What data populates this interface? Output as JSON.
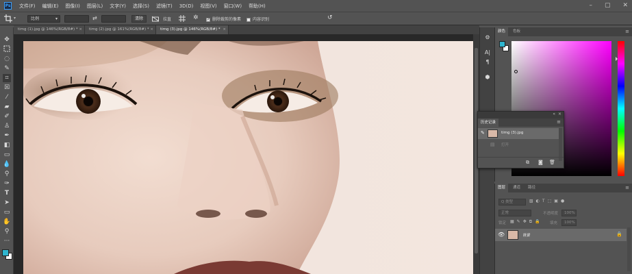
{
  "menubar": {
    "items": [
      "文件(F)",
      "编辑(E)",
      "图像(I)",
      "图层(L)",
      "文字(Y)",
      "选择(S)",
      "滤镜(T)",
      "3D(D)",
      "视图(V)",
      "窗口(W)",
      "帮助(H)"
    ]
  },
  "options_bar": {
    "ratio_dropdown": "比例",
    "clear_label": "清除",
    "straighten_label": "拉直",
    "delete_cropped_label": "删除裁剪的像素",
    "content_aware_label": "内容识别"
  },
  "tabs": [
    {
      "label": "timg (1).jpg @ 146%(RGB/8#) *"
    },
    {
      "label": "timg (2).jpg @ 161%(RGB/8#) *"
    },
    {
      "label": "timg (3).jpg @ 146%(RGB/8#) *"
    }
  ],
  "color_panel": {
    "tabs": [
      "颜色",
      "色板"
    ],
    "foreground_color": "#2fb6cf",
    "hue_color": "#ff00ff"
  },
  "history_panel": {
    "tab": "历史记录",
    "items": [
      {
        "label": "timg (3).jpg"
      },
      {
        "label": "打开"
      }
    ]
  },
  "layers_panel": {
    "tabs": [
      "图层",
      "通道",
      "路径"
    ],
    "filter_label": "Q 类型",
    "blend_mode": "正常",
    "opacity_label": "不透明度",
    "opacity_value": "100%",
    "lock_label": "锁定",
    "fill_label": "填充",
    "fill_value": "100%",
    "layer_name": "背景"
  }
}
